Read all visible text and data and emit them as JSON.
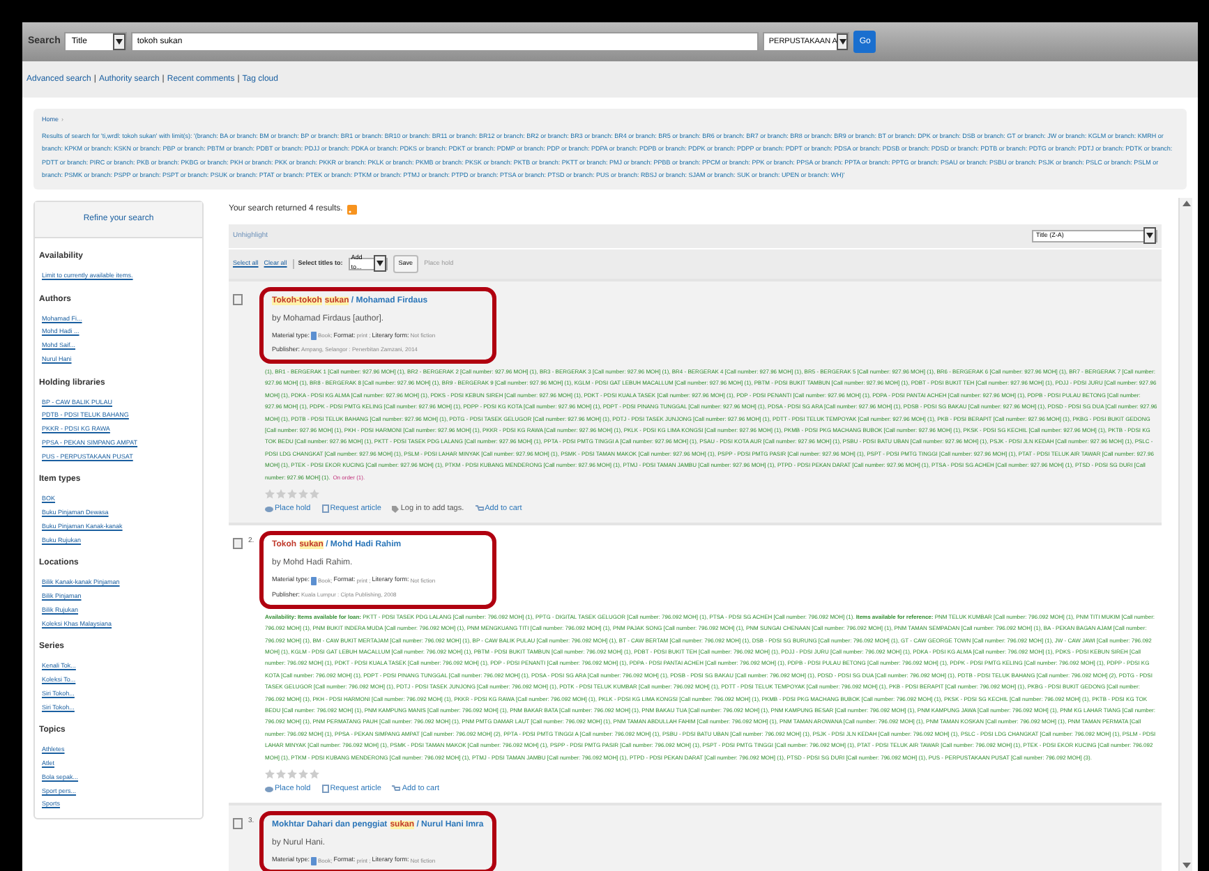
{
  "header": {
    "label": "Search",
    "index_select": "Title",
    "query": "tokoh sukan",
    "library_select": "PERPUSTAKAAN A",
    "go": "Go"
  },
  "links": {
    "items": [
      "Advanced search",
      "Authority search",
      "Recent comments",
      "Tag cloud"
    ],
    "separator": "|"
  },
  "breadcrumb": {
    "home": "Home",
    "arrow": "›",
    "text": "Results of search for 'ti,wrdl: tokoh sukan' with limit(s): '(branch: BA or branch: BM or branch: BP or branch: BR1 or branch: BR10 or branch: BR11 or branch: BR12 or branch: BR2 or branch: BR3 or branch: BR4 or branch: BR5 or branch: BR6 or branch: BR7 or branch: BR8 or branch: BR9 or branch: BT or branch: DPK or branch: DSB or branch: GT or branch: JW or branch: KGLM or branch: KMRH or branch: KPKM or branch: KSKN or branch: PBP or branch: PBTM or branch: PDBT or branch: PDJJ or branch: PDKA or branch: PDKS or branch: PDKT or branch: PDMP or branch: PDP or branch: PDPA or branch: PDPB or branch: PDPK or branch: PDPP or branch: PDPT or branch: PDSA or branch: PDSB or branch: PDSD or branch: PDTB or branch: PDTG or branch: PDTJ or branch: PDTK or branch: PDTT or branch: PIRC or branch: PKB or branch: PKBG or branch: PKH or branch: PKK or branch: PKKR or branch: PKLK or branch: PKMB or branch: PKSK or branch: PKTB or branch: PKTT or branch: PMJ or branch: PPBB or branch: PPCM or branch: PPK or branch: PPSA or branch: PPTA or branch: PPTG or branch: PSAU or branch: PSBU or branch: PSJK or branch: PSLC or branch: PSLM or branch: PSMK or branch: PSPP or branch: PSPT or branch: PSUK or branch: PTAT or branch: PTEK or branch: PTKM or branch: PTMJ or branch: PTPD or branch: PTSA or branch: PTSD or branch: PUS or branch: RBSJ or branch: SJAM or branch: SUK or branch: UPEN or branch: WH)'"
  },
  "sidebar": {
    "title": "Refine your search",
    "facets": [
      {
        "heading": "Availability",
        "items": [
          "Limit to currently available items."
        ]
      },
      {
        "heading": "Authors",
        "items": [
          "Mohamad Fi...",
          "Mohd Hadi ...",
          "Mohd Saif...",
          "Nurul Hani"
        ]
      },
      {
        "heading": "Holding libraries",
        "items": [
          "BP - CAW BALIK PULAU",
          "PDTB - PDSI TELUK BAHANG",
          "PKKR - PDSI KG RAWA",
          "PPSA - PEKAN SIMPANG AMPAT",
          "PUS - PERPUSTAKAAN PUSAT"
        ]
      },
      {
        "heading": "Item types",
        "items": [
          "BOK",
          "Buku Pinjaman Dewasa",
          "Buku Pinjaman Kanak-kanak",
          "Buku Rujukan"
        ]
      },
      {
        "heading": "Locations",
        "items": [
          "Bilik Kanak-kanak Pinjaman",
          "Bilik Pinjaman",
          "Bilik Rujukan",
          "Koleksi Khas Malaysiana"
        ]
      },
      {
        "heading": "Series",
        "items": [
          "Kenali Tok...",
          "Koleksi To...",
          "Siri Tokoh...",
          "Siri Tokoh..."
        ]
      },
      {
        "heading": "Topics",
        "items": [
          "Athletes",
          "Atlet",
          "Bola sepak...",
          "Sport pers...",
          "Sports"
        ]
      }
    ]
  },
  "summary": "Your search returned 4 results.",
  "toolbar": {
    "unhighlight": "Unhighlight",
    "select_all": "Select all",
    "clear_all": "Clear all",
    "select_label": "Select titles to:",
    "add_select": "Add to...",
    "save": "Save",
    "place_hold": "Place hold",
    "sort": "Title (Z-A)"
  },
  "results": [
    {
      "visited": true,
      "checked": false,
      "title_parts": [
        {
          "text": "Tokoh-tokoh",
          "highlight": true
        },
        {
          "text": "sukan",
          "highlight": true
        }
      ],
      "author_link": " / Mohamad Firdaus",
      "by": "by Mohamad Firdaus [author].",
      "details": [
        {
          "label": "Material type:",
          "value": "Book;"
        },
        {
          "label": "Format:",
          "value": "print ;"
        },
        {
          "label": "Literary form:",
          "value": "Not fiction"
        }
      ],
      "publisher_label": "Publisher:",
      "publisher": "Ampang, Selangor : Penerbitan Zamzani, 2014",
      "availability": "(1), BR1 - BERGERAK 1 [Call number: 927.96 MOH] (1), BR2 - BERGERAK 2 [Call number: 927.96 MOH] (1), BR3 - BERGERAK 3 [Call number: 927.96 MOH] (1), BR4 - BERGERAK 4 [Call number: 927.96 MOH] (1), BR5 - BERGERAK 5 [Call number: 927.96 MOH] (1), BR6 - BERGERAK 6 [Call number: 927.96 MOH] (1), BR7 - BERGERAK 7 [Call number: 927.96 MOH] (1), BR8 - BERGERAK 8 [Call number: 927.96 MOH] (1), BR9 - BERGERAK 9 [Call number: 927.96 MOH] (1), KGLM - PDSI GAT LEBUH MACALLUM [Call number: 927.96 MOH] (1), PBTM - PDSI BUKIT TAMBUN [Call number: 927.96 MOH] (1), PDBT - PDSI BUKIT TEH [Call number: 927.96 MOH] (1), PDJJ - PDSI JURU [Call number: 927.96 MOH] (1), PDKA - PDSI KG ALMA [Call number: 927.96 MOH] (1), PDKS - PDSI KEBUN SIREH [Call number: 927.96 MOH] (1), PDKT - PDSI KUALA TASEK [Call number: 927.96 MOH] (1), PDP - PDSI PENANTI [Call number: 927.96 MOH] (1), PDPA - PDSI PANTAI ACHEH [Call number: 927.96 MOH] (1), PDPB - PDSI PULAU BETONG [Call number: 927.96 MOH] (1), PDPK - PDSI PMTG KELING [Call number: 927.96 MOH] (1), PDPP - PDSI KG KOTA [Call number: 927.96 MOH] (1), PDPT - PDSI PINANG TUNGGAL [Call number: 927.96 MOH] (1), PDSA - PDSI SG ARA [Call number: 927.96 MOH] (1), PDSB - PDSI SG BAKAU [Call number: 927.96 MOH] (1), PDSD - PDSI SG DUA [Call number: 927.96 MOH] (1), PDTB - PDSI TELUK BAHANG [Call number: 927.96 MOH] (1), PDTG - PDSI TASEK GELUGOR [Call number: 927.96 MOH] (1), PDTJ - PDSI TASEK JUNJONG [Call number: 927.96 MOH] (1), PDTT - PDSI TELUK TEMPOYAK [Call number: 927.96 MOH] (1), PKB - PDSI BERAPIT [Call number: 927.96 MOH] (1), PKBG - PDSI BUKIT GEDONG [Call number: 927.96 MOH] (1), PKH - PDSI HARMONI [Call number: 927.96 MOH] (1), PKKR - PDSI KG RAWA [Call number: 927.96 MOH] (1), PKLK - PDSI KG LIMA KONGSI [Call number: 927.96 MOH] (1), PKMB - PDSI PKG MACHANG BUBOK [Call number: 927.96 MOH] (1), PKSK - PDSI SG KECHIL [Call number: 927.96 MOH] (1), PKTB - PDSI KG TOK BEDU [Call number: 927.96 MOH] (1), PKTT - PDSI TASEK PDG LALANG [Call number: 927.96 MOH] (1), PPTA - PDSI PMTG TINGGI A [Call number: 927.96 MOH] (1), PSAU - PDSI KOTA AUR [Call number: 927.96 MOH] (1), PSBU - PDSI BATU UBAN [Call number: 927.96 MOH] (1), PSJK - PDSI JLN KEDAH [Call number: 927.96 MOH] (1), PSLC - PDSI LDG CHANGKAT [Call number: 927.96 MOH] (1), PSLM - PDSI LAHAR MINYAK [Call number: 927.96 MOH] (1), PSMK - PDSI TAMAN MAKOK [Call number: 927.96 MOH] (1), PSPP - PDSI PMTG PASIR [Call number: 927.96 MOH] (1), PSPT - PDSI PMTG TINGGI [Call number: 927.96 MOH] (1), PTAT - PDSI TELUK AIR TAWAR [Call number: 927.96 MOH] (1), PTEK - PDSI EKOR KUCING [Call number: 927.96 MOH] (1), PTKM - PDSI KUBANG MENDERONG [Call number: 927.96 MOH] (1), PTMJ - PDSI TAMAN JAMBU [Call number: 927.96 MOH] (1), PTPD - PDSI PEKAN DARAT [Call number: 927.96 MOH] (1), PTSA - PDSI SG ACHEH [Call number: 927.96 MOH] (1), PTSD - PDSI SG DURI [Call number: 927.96 MOH] (1).",
      "on_order": "On order (1).",
      "stars": 0,
      "actions": [
        "Place hold",
        "Request article",
        "Log in to add tags.",
        "Add to cart"
      ]
    },
    {
      "number": "2.",
      "visited": true,
      "checked": false,
      "title_parts": [
        {
          "text": "Tokoh",
          "highlight": false
        },
        {
          "text": "sukan",
          "highlight": true
        }
      ],
      "author_link": " / Mohd Hadi Rahim",
      "by": "by Mohd Hadi Rahim.",
      "details": [
        {
          "label": "Material type:",
          "value": "Book;"
        },
        {
          "label": "Format:",
          "value": "print ;"
        },
        {
          "label": "Literary form:",
          "value": "Not fiction"
        }
      ],
      "publisher_label": "Publisher:",
      "publisher": "Kuala Lumpur : Cipta Publishing, 2008",
      "availability": "**Availability:** **Items available for loan:** PKTT - PDSI TASEK PDG LALANG [Call number: 796.092 MOH] (1), PPTG - DIGITAL TASEK GELUGOR [Call number: 796.092 MOH] (1), PTSA - PDSI SG ACHEH [Call number: 796.092 MOH] (1). **Items available for reference:** PNM TELUK KUMBAR [Call number: 796.092 MOH] (1), PNM TITI MUKIM [Call number: 796.092 MOH] (1), PNM BUKIT INDERA MUDA [Call number: 796.092 MOH] (1), PNM MENGKUANG TITI [Call number: 796.092 MOH] (1), PNM PAJAK SONG [Call number: 796.092 MOH] (1), PNM SUNGAI CHENAAN [Call number: 796.092 MOH] (1), PNM TAMAN SEMPADAN [Call number: 796.092 MOH] (1), BA - PEKAN BAGAN AJAM [Call number: 796.092 MOH] (1), BM - CAW BUKIT MERTAJAM [Call number: 796.092 MOH] (1), BP - CAW BALIK PULAU [Call number: 796.092 MOH] (1), BT - CAW BERTAM [Call number: 796.092 MOH] (1), DSB - PDSI SG BURUNG [Call number: 796.092 MOH] (1), GT - CAW GEORGE TOWN [Call number: 796.092 MOH] (1), JW - CAW JAWI [Call number: 796.092 MOH] (1), KGLM - PDSI GAT LEBUH MACALLUM [Call number: 796.092 MOH] (1), PBTM - PDSI BUKIT TAMBUN [Call number: 796.092 MOH] (1), PDBT - PDSI BUKIT TEH [Call number: 796.092 MOH] (1), PDJJ - PDSI JURU [Call number: 796.092 MOH] (1), PDKA - PDSI KG ALMA [Call number: 796.092 MOH] (1), PDKS - PDSI KEBUN SIREH [Call number: 796.092 MOH] (1), PDKT - PDSI KUALA TASEK [Call number: 796.092 MOH] (1), PDP - PDSI PENANTI [Call number: 796.092 MOH] (1), PDPA - PDSI PANTAI ACHEH [Call number: 796.092 MOH] (1), PDPB - PDSI PULAU BETONG [Call number: 796.092 MOH] (1), PDPK - PDSI PMTG KELING [Call number: 796.092 MOH] (1), PDPP - PDSI KG KOTA [Call number: 796.092 MOH] (1), PDPT - PDSI PINANG TUNGGAL [Call number: 796.092 MOH] (1), PDSA - PDSI SG ARA [Call number: 796.092 MOH] (1), PDSB - PDSI SG BAKAU [Call number: 796.092 MOH] (1), PDSD - PDSI SG DUA [Call number: 796.092 MOH] (1), PDTB - PDSI TELUK BAHANG [Call number: 796.092 MOH] (2), PDTG - PDSI TASEK GELUGOR [Call number: 796.092 MOH] (1), PDTJ - PDSI TASEK JUNJONG [Call number: 796.092 MOH] (1), PDTK - PDSI TELUK KUMBAR [Call number: 796.092 MOH] (1), PDTT - PDSI TELUK TEMPOYAK [Call number: 796.092 MOH] (1), PKB - PDSI BERAPIT [Call number: 796.092 MOH] (1), PKBG - PDSI BUKIT GEDONG [Call number: 796.092 MOH] (1), PKH - PDSI HARMONI [Call number: 796.092 MOH] (1), PKKR - PDSI KG RAWA [Call number: 796.092 MOH] (1), PKLK - PDSI KG LIMA KONGSI [Call number: 796.092 MOH] (1), PKMB - PDSI PKG MACHANG BUBOK [Call number: 796.092 MOH] (1), PKSK - PDSI SG KECHIL [Call number: 796.092 MOH] (1), PKTB - PDSI KG TOK BEDU [Call number: 796.092 MOH] (1), PNM KAMPUNG MANIS [Call number: 796.092 MOH] (1), PNM BAKAR BATA [Call number: 796.092 MOH] (1), PNM BAKAU TUA [Call number: 796.092 MOH] (1), PNM KAMPUNG BESAR [Call number: 796.092 MOH] (1), PNM KAMPUNG JAWA [Call number: 796.092 MOH] (1), PNM KG LAHAR TIANG [Call number: 796.092 MOH] (1), PNM PERMATANG PAUH [Call number: 796.092 MOH] (1), PNM PMTG DAMAR LAUT [Call number: 796.092 MOH] (1), PNM TAMAN ABDULLAH FAHIM [Call number: 796.092 MOH] (1), PNM TAMAN AROWANA [Call number: 796.092 MOH] (1), PNM TAMAN KOSKAN [Call number: 796.092 MOH] (1), PNM TAMAN PERMATA [Call number: 796.092 MOH] (1), PPSA - PEKAN SIMPANG AMPAT [Call number: 796.092 MOH] (2), PPTA - PDSI PMTG TINGGI A [Call number: 796.092 MOH] (1), PSBU - PDSI BATU UBAN [Call number: 796.092 MOH] (1), PSJK - PDSI JLN KEDAH [Call number: 796.092 MOH] (1), PSLC - PDSI LDG CHANGKAT [Call number: 796.092 MOH] (1), PSLM - PDSI LAHAR MINYAK [Call number: 796.092 MOH] (1), PSMK - PDSI TAMAN MAKOK [Call number: 796.092 MOH] (1), PSPP - PDSI PMTG PASIR [Call number: 796.092 MOH] (1), PSPT - PDSI PMTG TINGGI [Call number: 796.092 MOH] (1), PTAT - PDSI TELUK AIR TAWAR [Call number: 796.092 MOH] (1), PTEK - PDSI EKOR KUCING [Call number: 796.092 MOH] (1), PTKM - PDSI KUBANG MENDERONG [Call number: 796.092 MOH] (1), PTMJ - PDSI TAMAN JAMBU [Call number: 796.092 MOH] (1), PTPD - PDSI PEKAN DARAT [Call number: 796.092 MOH] (1), PTSD - PDSI SG DURI [Call number: 796.092 MOH] (1), PUS - PERPUSTAKAAN PUSAT [Call number: 796.092 MOH] (3).",
      "stars": 0,
      "actions": [
        "Place hold",
        "Request article",
        "Add to cart"
      ]
    },
    {
      "number": "3.",
      "visited": false,
      "checked": false,
      "title_parts": [
        {
          "text": "Mokhtar Dahari dan penggiat",
          "highlight": false
        },
        {
          "text": "sukan",
          "highlight": true
        }
      ],
      "author_link": " / Nurul Hani Imra",
      "by": "by Nurul Hani.",
      "details": [
        {
          "label": "Material type:",
          "value": "Book;"
        },
        {
          "label": "Format:",
          "value": "print ;"
        },
        {
          "label": "Literary form:",
          "value": "Not fiction"
        }
      ]
    }
  ]
}
